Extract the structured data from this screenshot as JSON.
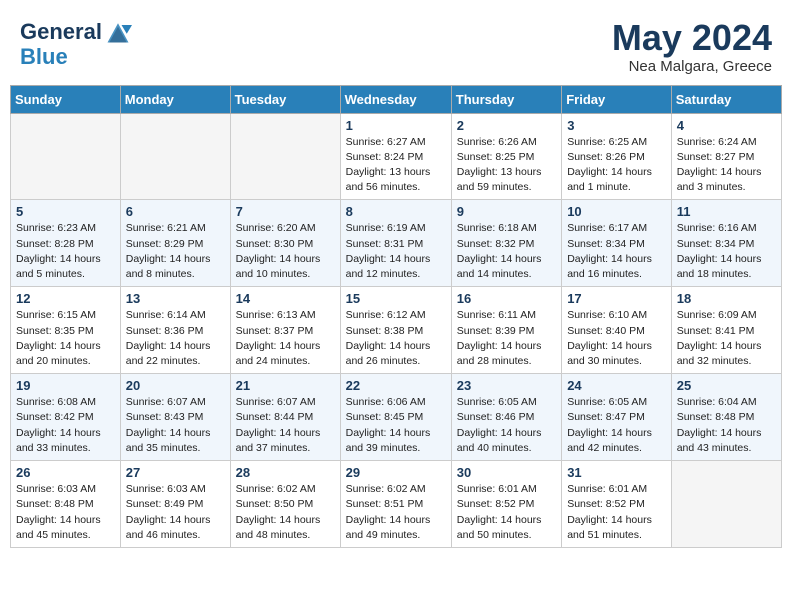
{
  "header": {
    "logo_line1": "General",
    "logo_line2": "Blue",
    "month_title": "May 2024",
    "location": "Nea Malgara, Greece"
  },
  "days_of_week": [
    "Sunday",
    "Monday",
    "Tuesday",
    "Wednesday",
    "Thursday",
    "Friday",
    "Saturday"
  ],
  "weeks": [
    [
      {
        "day": "",
        "info": ""
      },
      {
        "day": "",
        "info": ""
      },
      {
        "day": "",
        "info": ""
      },
      {
        "day": "1",
        "info": "Sunrise: 6:27 AM\nSunset: 8:24 PM\nDaylight: 13 hours\nand 56 minutes."
      },
      {
        "day": "2",
        "info": "Sunrise: 6:26 AM\nSunset: 8:25 PM\nDaylight: 13 hours\nand 59 minutes."
      },
      {
        "day": "3",
        "info": "Sunrise: 6:25 AM\nSunset: 8:26 PM\nDaylight: 14 hours\nand 1 minute."
      },
      {
        "day": "4",
        "info": "Sunrise: 6:24 AM\nSunset: 8:27 PM\nDaylight: 14 hours\nand 3 minutes."
      }
    ],
    [
      {
        "day": "5",
        "info": "Sunrise: 6:23 AM\nSunset: 8:28 PM\nDaylight: 14 hours\nand 5 minutes."
      },
      {
        "day": "6",
        "info": "Sunrise: 6:21 AM\nSunset: 8:29 PM\nDaylight: 14 hours\nand 8 minutes."
      },
      {
        "day": "7",
        "info": "Sunrise: 6:20 AM\nSunset: 8:30 PM\nDaylight: 14 hours\nand 10 minutes."
      },
      {
        "day": "8",
        "info": "Sunrise: 6:19 AM\nSunset: 8:31 PM\nDaylight: 14 hours\nand 12 minutes."
      },
      {
        "day": "9",
        "info": "Sunrise: 6:18 AM\nSunset: 8:32 PM\nDaylight: 14 hours\nand 14 minutes."
      },
      {
        "day": "10",
        "info": "Sunrise: 6:17 AM\nSunset: 8:34 PM\nDaylight: 14 hours\nand 16 minutes."
      },
      {
        "day": "11",
        "info": "Sunrise: 6:16 AM\nSunset: 8:34 PM\nDaylight: 14 hours\nand 18 minutes."
      }
    ],
    [
      {
        "day": "12",
        "info": "Sunrise: 6:15 AM\nSunset: 8:35 PM\nDaylight: 14 hours\nand 20 minutes."
      },
      {
        "day": "13",
        "info": "Sunrise: 6:14 AM\nSunset: 8:36 PM\nDaylight: 14 hours\nand 22 minutes."
      },
      {
        "day": "14",
        "info": "Sunrise: 6:13 AM\nSunset: 8:37 PM\nDaylight: 14 hours\nand 24 minutes."
      },
      {
        "day": "15",
        "info": "Sunrise: 6:12 AM\nSunset: 8:38 PM\nDaylight: 14 hours\nand 26 minutes."
      },
      {
        "day": "16",
        "info": "Sunrise: 6:11 AM\nSunset: 8:39 PM\nDaylight: 14 hours\nand 28 minutes."
      },
      {
        "day": "17",
        "info": "Sunrise: 6:10 AM\nSunset: 8:40 PM\nDaylight: 14 hours\nand 30 minutes."
      },
      {
        "day": "18",
        "info": "Sunrise: 6:09 AM\nSunset: 8:41 PM\nDaylight: 14 hours\nand 32 minutes."
      }
    ],
    [
      {
        "day": "19",
        "info": "Sunrise: 6:08 AM\nSunset: 8:42 PM\nDaylight: 14 hours\nand 33 minutes."
      },
      {
        "day": "20",
        "info": "Sunrise: 6:07 AM\nSunset: 8:43 PM\nDaylight: 14 hours\nand 35 minutes."
      },
      {
        "day": "21",
        "info": "Sunrise: 6:07 AM\nSunset: 8:44 PM\nDaylight: 14 hours\nand 37 minutes."
      },
      {
        "day": "22",
        "info": "Sunrise: 6:06 AM\nSunset: 8:45 PM\nDaylight: 14 hours\nand 39 minutes."
      },
      {
        "day": "23",
        "info": "Sunrise: 6:05 AM\nSunset: 8:46 PM\nDaylight: 14 hours\nand 40 minutes."
      },
      {
        "day": "24",
        "info": "Sunrise: 6:05 AM\nSunset: 8:47 PM\nDaylight: 14 hours\nand 42 minutes."
      },
      {
        "day": "25",
        "info": "Sunrise: 6:04 AM\nSunset: 8:48 PM\nDaylight: 14 hours\nand 43 minutes."
      }
    ],
    [
      {
        "day": "26",
        "info": "Sunrise: 6:03 AM\nSunset: 8:48 PM\nDaylight: 14 hours\nand 45 minutes."
      },
      {
        "day": "27",
        "info": "Sunrise: 6:03 AM\nSunset: 8:49 PM\nDaylight: 14 hours\nand 46 minutes."
      },
      {
        "day": "28",
        "info": "Sunrise: 6:02 AM\nSunset: 8:50 PM\nDaylight: 14 hours\nand 48 minutes."
      },
      {
        "day": "29",
        "info": "Sunrise: 6:02 AM\nSunset: 8:51 PM\nDaylight: 14 hours\nand 49 minutes."
      },
      {
        "day": "30",
        "info": "Sunrise: 6:01 AM\nSunset: 8:52 PM\nDaylight: 14 hours\nand 50 minutes."
      },
      {
        "day": "31",
        "info": "Sunrise: 6:01 AM\nSunset: 8:52 PM\nDaylight: 14 hours\nand 51 minutes."
      },
      {
        "day": "",
        "info": ""
      }
    ]
  ]
}
